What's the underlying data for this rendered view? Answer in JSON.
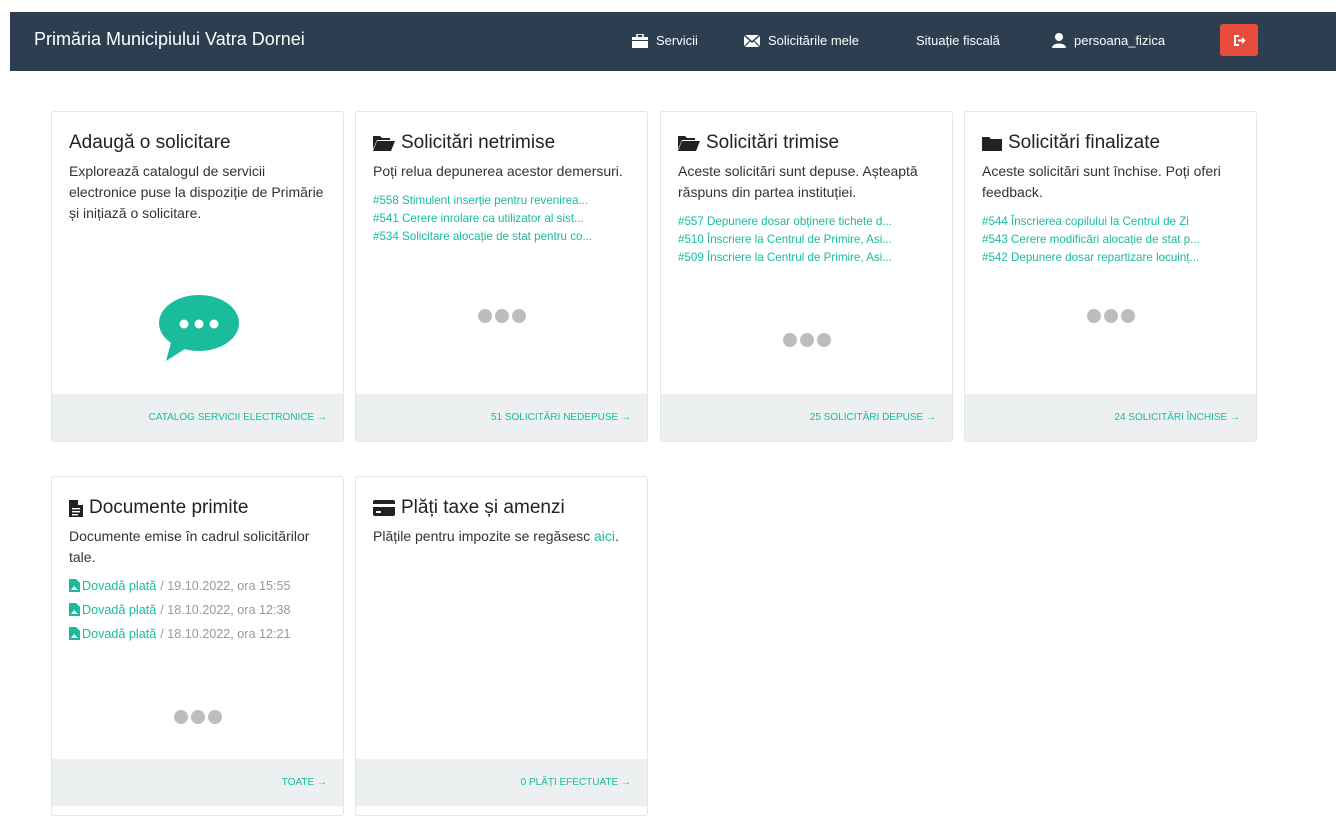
{
  "header": {
    "brand": "Primăria Municipiului Vatra Dornei",
    "nav": {
      "services": "Servicii",
      "my_requests": "Solicitările mele",
      "fiscal": "Situație fiscală",
      "user": "persoana_fizica"
    }
  },
  "colors": {
    "navbar": "#2c3e50",
    "accent": "#18bc9c",
    "logout": "#e74c3c",
    "footer": "#ecf0f1"
  },
  "cards": {
    "add": {
      "title": "Adaugă o solicitare",
      "desc": "Explorează catalogul de servicii electronice puse la dispoziție de Primărie și inițiază o solicitare.",
      "icon": "chat-bubble-icon",
      "footer": "Catalog servicii electronice →"
    },
    "drafts": {
      "title": "Solicitări netrimise",
      "desc": "Poți relua depunerea acestor demersuri.",
      "items": [
        "#558 Stimulent inserție pentru revenirea...",
        "#541 Cerere inrolare ca utilizator al sist...",
        "#534 Solicitare alocație de stat pentru co..."
      ],
      "footer": "51 solicitări nedepuse →"
    },
    "sent": {
      "title": "Solicitări trimise",
      "desc": "Aceste solicitări sunt depuse. Așteaptă răspuns din partea instituției.",
      "items": [
        "#557 Depunere dosar obținere tichete d...",
        "#510 Înscriere la Centrul de Primire, Asi...",
        "#509 Înscriere la Centrul de Primire, Asi..."
      ],
      "footer": "25 solicitări depuse →"
    },
    "closed": {
      "title": "Solicitări finalizate",
      "desc": "Aceste solicitări sunt închise. Poți oferi feedback.",
      "items": [
        "#544 Înscrierea copilului la Centrul de Zi",
        "#543 Cerere modificări alocație de stat p...",
        "#542 Depunere dosar repartizare locuinț..."
      ],
      "footer": "24 solicitări închise →"
    },
    "documents": {
      "title": "Documente primite",
      "desc": "Documente emise în cadrul solicitărilor tale.",
      "items": [
        {
          "label": "Dovadă plată",
          "date": "/ 19.10.2022, ora 15:55"
        },
        {
          "label": "Dovadă plată",
          "date": "/ 18.10.2022, ora 12:38"
        },
        {
          "label": "Dovadă plată",
          "date": "/ 18.10.2022, ora 12:21"
        }
      ],
      "footer": "Toate →"
    },
    "payments": {
      "title": "Plăți taxe și amenzi",
      "desc": "Plățile pentru impozite se regăsesc",
      "link": "aici",
      "link_suffix": ".",
      "footer": "0 plăți efectuate →"
    }
  }
}
